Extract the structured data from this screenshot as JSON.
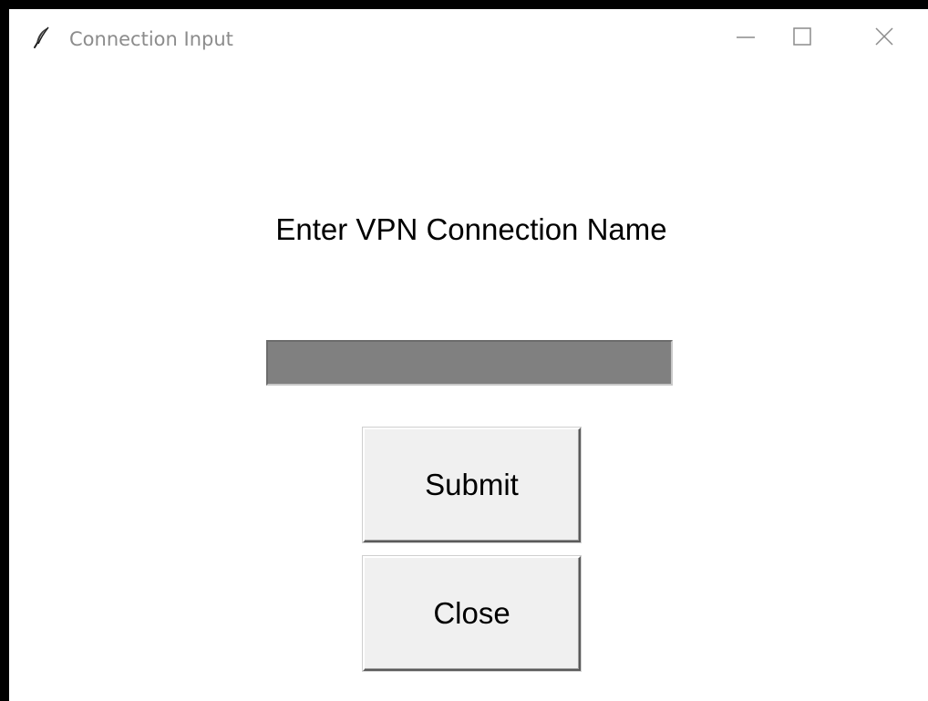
{
  "window": {
    "title": "Connection Input",
    "controls": {
      "minimize_icon": "minimize-icon",
      "maximize_icon": "maximize-icon",
      "close_icon": "close-icon"
    }
  },
  "form": {
    "prompt": "Enter VPN Connection Name",
    "connection_name": {
      "value": "",
      "placeholder": ""
    },
    "submit_label": "Submit",
    "close_label": "Close"
  },
  "colors": {
    "entry_background": "#808080",
    "button_background": "#f0f0f0",
    "title_text": "#8c8c8c",
    "window_background": "#ffffff"
  }
}
